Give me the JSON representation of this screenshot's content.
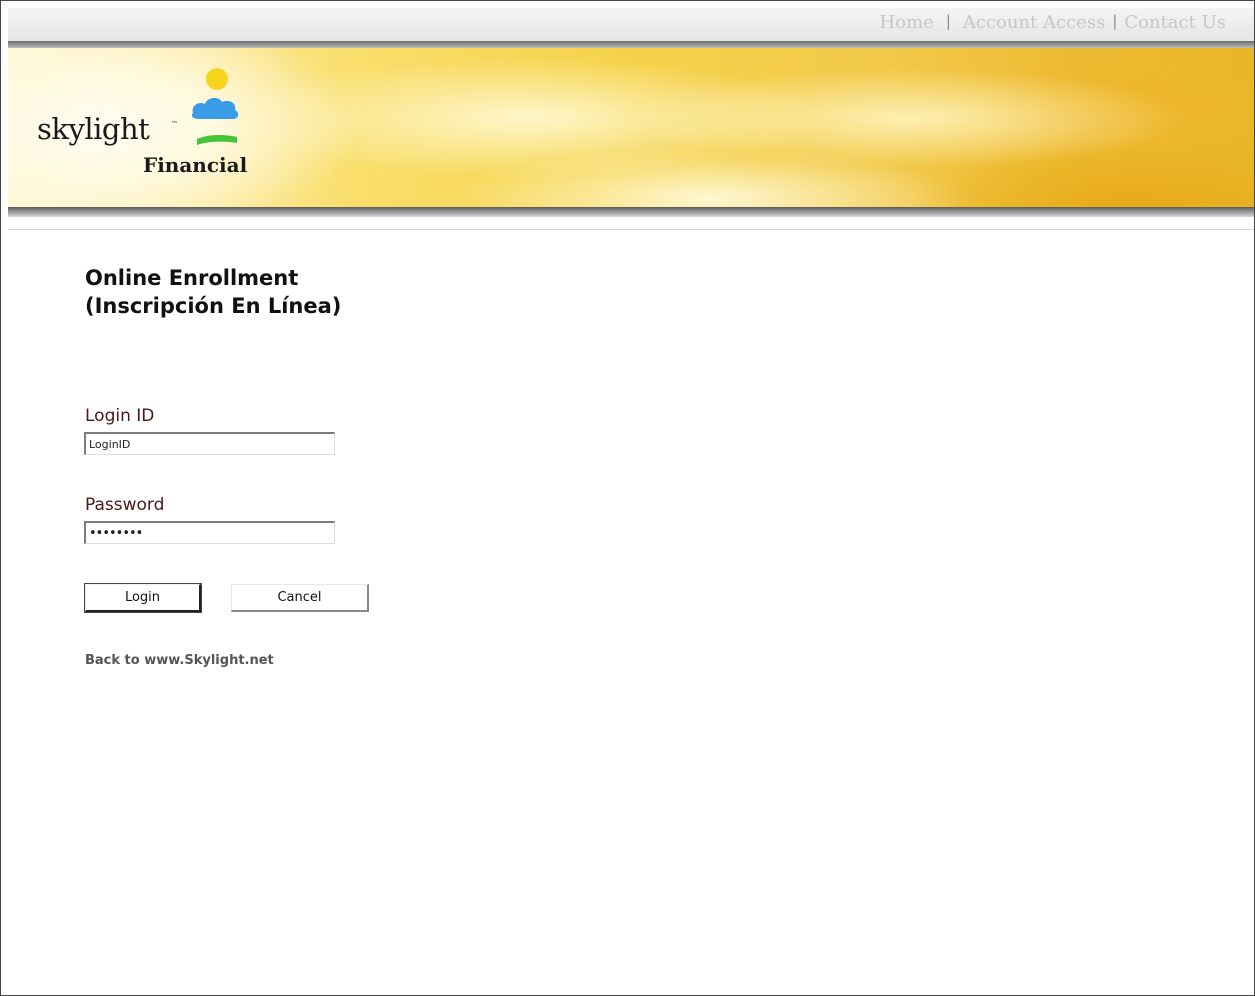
{
  "topnav": {
    "items": [
      {
        "label": "Home"
      },
      {
        "label": "Account Access"
      },
      {
        "label": "Contact Us"
      }
    ],
    "separator": "|"
  },
  "brand": {
    "name_line1": "skylight",
    "trademark": "™",
    "name_line2": "Financial",
    "colors": {
      "sun": "#f7d51d",
      "cloud": "#3a9be6",
      "grass": "#44c53a"
    }
  },
  "page": {
    "title_line1": "Online Enrollment",
    "title_line2": "(Inscripción En Línea)"
  },
  "form": {
    "login_label": "Login ID",
    "login_value": "LoginID",
    "password_label": "Password",
    "password_value": "••••••••",
    "login_button": "Login",
    "cancel_button": "Cancel"
  },
  "footer_link": "Back to www.Skylight.net"
}
